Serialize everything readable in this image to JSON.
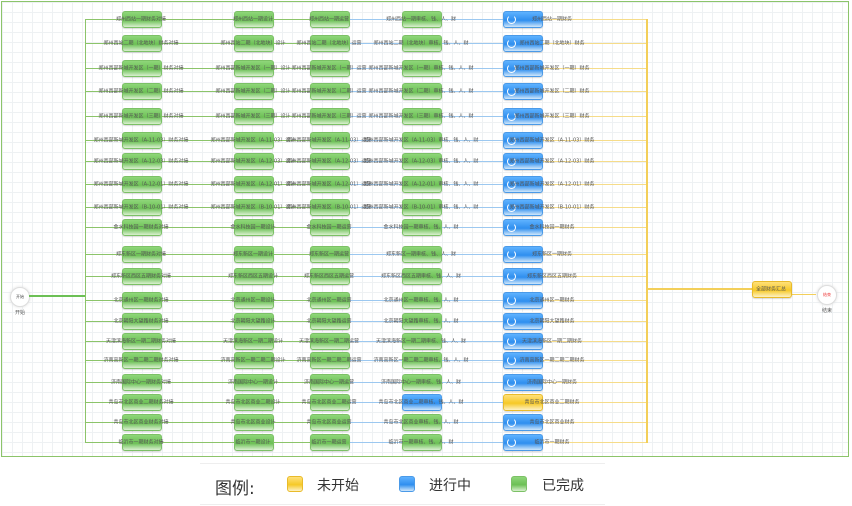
{
  "diagram": {
    "start": {
      "inner": "开始",
      "label": "开始"
    },
    "end": {
      "inner": "结束",
      "label": "结束"
    },
    "summary_node": "全部财务汇总",
    "rows": [
      {
        "s": [
          "郑州西站一期财务对接",
          "郑州西站一期设计",
          "郑州西站一期运营",
          "郑州西站一期审核、钱、人、财",
          "郑州西站一期财务"
        ],
        "st": [
          "g",
          "g",
          "g",
          "g",
          "b"
        ]
      },
      {
        "s": [
          "郑州西站二期（北地块）财务对接",
          "郑州西站二期（北地块）设计",
          "郑州西站二期（北地块）运营",
          "郑州西站二期（北地块）审核、钱、人、财",
          "郑州西站二期（北地块）财务"
        ],
        "st": [
          "g",
          "g",
          "g",
          "g",
          "b"
        ]
      },
      {
        "s": [
          "郑州西部新城开发区（一期）财务对接",
          "郑州西部新城开发区（一期）设计",
          "郑州西部新城开发区（一期）运营",
          "郑州西部新城开发区（一期）审核、钱、人、财",
          "郑州西部新城开发区（一期）财务"
        ],
        "st": [
          "g",
          "g",
          "g",
          "g",
          "b"
        ]
      },
      {
        "s": [
          "郑州西部新城开发区（二期）财务对接",
          "郑州西部新城开发区（二期）设计",
          "郑州西部新城开发区（二期）运营",
          "郑州西部新城开发区（二期）审核、钱、人、财",
          "郑州西部新城开发区（二期）财务"
        ],
        "st": [
          "g",
          "g",
          "g",
          "g",
          "b"
        ]
      },
      {
        "s": [
          "郑州西部新城开发区（三期）财务对接",
          "郑州西部新城开发区（三期）设计",
          "郑州西部新城开发区（三期）运营",
          "郑州西部新城开发区（三期）审核、钱、人、财",
          "郑州西部新城开发区（三期）财务"
        ],
        "st": [
          "g",
          "g",
          "g",
          "g",
          "b"
        ]
      },
      {
        "s": [
          "郑州西部新城开发区（A-11-03）财务对接",
          "郑州西部新城开发区（A-11-03）设计",
          "郑州西部新城开发区（A-11-03）运营",
          "郑州西部新城开发区（A-11-03）审核、钱、人、财",
          "郑州西部新城开发区（A-11-03）财务"
        ],
        "st": [
          "g",
          "g",
          "g",
          "g",
          "b"
        ]
      },
      {
        "s": [
          "郑州西部新城开发区（A-12-03）财务对接",
          "郑州西部新城开发区（A-12-03）设计",
          "郑州西部新城开发区（A-12-03）运营",
          "郑州西部新城开发区（A-12-03）审核、钱、人、财",
          "郑州西部新城开发区（A-12-03）财务"
        ],
        "st": [
          "g",
          "g",
          "g",
          "g",
          "b"
        ]
      },
      {
        "s": [
          "郑州西部新城开发区（A-12-01）财务对接",
          "郑州西部新城开发区（A-12-01）设计",
          "郑州西部新城开发区（A-12-01）运营",
          "郑州西部新城开发区（A-12-01）审核、钱、人、财",
          "郑州西部新城开发区（A-12-01）财务"
        ],
        "st": [
          "g",
          "g",
          "g",
          "g",
          "b"
        ]
      },
      {
        "s": [
          "郑州西部新城开发区（B-10-01）财务对接",
          "郑州西部新城开发区（B-10-01）设计",
          "郑州西部新城开发区（B-10-01）运营",
          "郑州西部新城开发区（B-10-01）审核、钱、人、财",
          "郑州西部新城开发区（B-10-01）财务"
        ],
        "st": [
          "g",
          "g",
          "g",
          "g",
          "b"
        ]
      },
      {
        "s": [
          "金水科技园一期财务对接",
          "金水科技园一期设计",
          "金水科技园一期运营",
          "金水科技园一期审核、钱、人、财",
          "金水科技园一期财务"
        ],
        "st": [
          "g",
          "g",
          "g",
          "g",
          "b"
        ]
      },
      {
        "s": [
          "郑东新区一期财务对接",
          "郑东新区一期设计",
          "郑东新区一期运营",
          "郑东新区一期审核、钱、人、财",
          "郑东新区一期财务"
        ],
        "st": [
          "g",
          "g",
          "g",
          "g",
          "b"
        ]
      },
      {
        "s": [
          "郑东新区西区五期财务对接",
          "郑东新区西区五期设计",
          "郑东新区西区五期运营",
          "郑东新区西区五期审核、钱、人、财",
          "郑东新区西区五期财务"
        ],
        "st": [
          "g",
          "g",
          "g",
          "g",
          "b"
        ]
      },
      {
        "s": [
          "北京通州区一期财务对接",
          "北京通州区一期设计",
          "北京通州区一期运营",
          "北京通州区一期审核、钱、人、财",
          "北京通州区一期财务"
        ],
        "st": [
          "g",
          "g",
          "g",
          "g",
          "b"
        ]
      },
      {
        "s": [
          "北京朝阳大望路财务对接",
          "北京朝阳大望路设计",
          "北京朝阳大望路运营",
          "北京朝阳大望路审核、钱、人、财",
          "北京朝阳大望路财务"
        ],
        "st": [
          "g",
          "g",
          "g",
          "g",
          "b"
        ]
      },
      {
        "s": [
          "天津滨海新区一期二期财务对接",
          "天津滨海新区一期二期设计",
          "天津滨海新区一期二期运营",
          "天津滨海新区一期二期审核、钱、人、财",
          "天津滨海新区一期二期财务"
        ],
        "st": [
          "g",
          "g",
          "g",
          "g",
          "b"
        ]
      },
      {
        "s": [
          "济南高新区一期二期二期财务对接",
          "济南高新区一期二期二期设计",
          "济南高新区一期二期二期运营",
          "济南高新区一期二期二期审核、钱、人、财",
          "济南高新区一期二期二期财务"
        ],
        "st": [
          "g",
          "g",
          "g",
          "g",
          "b"
        ]
      },
      {
        "s": [
          "济南国际中心一期财务对接",
          "济南国际中心一期设计",
          "济南国际中心一期运营",
          "济南国际中心一期审核、钱、人、财",
          "济南国际中心一期财务"
        ],
        "st": [
          "g",
          "g",
          "g",
          "g",
          "b"
        ]
      },
      {
        "s": [
          "青岛市北区商业二期财务对接",
          "青岛市北区商业二期设计",
          "青岛市北区商业二期运营",
          "青岛市北区商业二期审核、钱、人、财",
          "青岛市北区商业二期财务"
        ],
        "st": [
          "g",
          "g",
          "g",
          "b",
          "y"
        ]
      },
      {
        "s": [
          "青岛市北区商业财务对接",
          "青岛市北区商业设计",
          "青岛市北区商业运营",
          "青岛市北区商业审核、钱、人、财",
          "青岛市北区商业财务"
        ],
        "st": [
          "g",
          "g",
          "g",
          "g",
          "b"
        ]
      },
      {
        "s": [
          "临沂市一期财务对接",
          "临沂市一期设计",
          "临沂市一期运营",
          "临沂市一期审核、钱、人、财",
          "临沂市一期财务"
        ],
        "st": [
          "g",
          "g",
          "g",
          "g",
          "b"
        ]
      }
    ]
  },
  "legend": {
    "title": "图例:",
    "items": [
      {
        "label": "未开始",
        "color": "#f6c927"
      },
      {
        "label": "进行中",
        "color": "#2f8fef"
      },
      {
        "label": "已完成",
        "color": "#6cc055"
      }
    ]
  }
}
